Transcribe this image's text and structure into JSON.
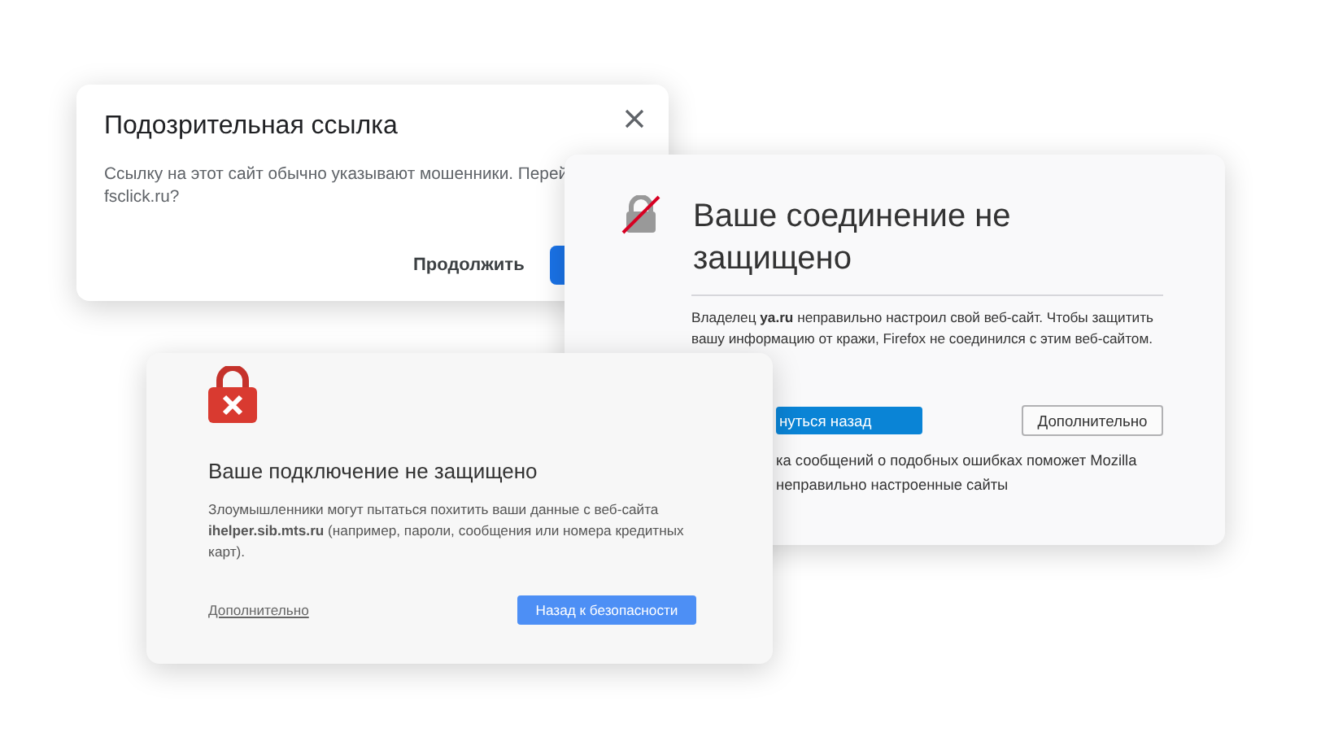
{
  "dialogs": [
    {
      "kind": "suspicious",
      "title": "Подозрительная ссылка",
      "lines": [
        "Ссылку на этот сайт обычно указывают мошенники. Перей",
        "fsclick.ru?"
      ],
      "secondary_button": "Продолжить"
    },
    {
      "kind": "firefox",
      "title": "Ваше соединение не защищено",
      "text": "Владелец **ya.ru** неправильно настроил свой веб-сайт. Чтобы защитить вашу информацию от кражи, Firefox не соединился с этим веб-сайтом.",
      "primary_button": "нуться назад",
      "secondary_button": "Дополнительно",
      "footer_lines": [
        "ка сообщений о подобных ошибках поможет Mozilla",
        "неправильно настроенные сайты"
      ]
    },
    {
      "kind": "chrome",
      "title": "Ваше подключение не защищено",
      "text": "Злоумышленники могут пытаться похитить ваши данные с веб-сайта **ihelper.sib.mts.ru** (например, пароли, сообщения или номера кредитных карт).",
      "link": "Дополнительно",
      "primary_button": "Назад к безопасности"
    }
  ]
}
